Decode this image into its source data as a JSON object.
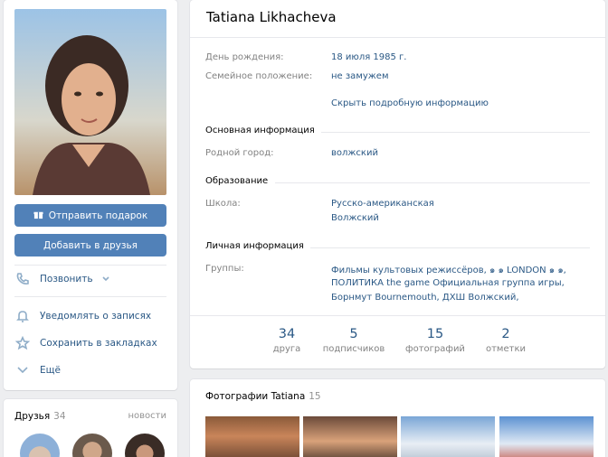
{
  "profile": {
    "name": "Tatiana Likhacheva",
    "birthday_label": "День рождения:",
    "birthday_value": "18 июля 1985 г.",
    "relationship_label": "Семейное положение:",
    "relationship_value": "не замужем",
    "hide_info": "Скрыть подробную информацию",
    "main_info_title": "Основная информация",
    "hometown_label": "Родной город:",
    "hometown_value": "волжский",
    "education_title": "Образование",
    "school_label": "Школа:",
    "school_value_1": "Русско-американская",
    "school_value_2": "Волжский",
    "personal_title": "Личная информация",
    "groups_label": "Группы:",
    "groups_line_1": "Фильмы культовых режиссёров, ๑ ๑ LONDON ๑ ๑,",
    "groups_line_2": "ПОЛИТИКА the game Официальная группа игры,",
    "groups_line_3": "Борнмут Bournemouth, ДХШ Волжский,"
  },
  "stats": [
    {
      "num": "34",
      "cap": "друга"
    },
    {
      "num": "5",
      "cap": "подписчиков"
    },
    {
      "num": "15",
      "cap": "фотографий"
    },
    {
      "num": "2",
      "cap": "отметки"
    }
  ],
  "left": {
    "gift_button": "Отправить подарок",
    "add_friend_button": "Добавить в друзья",
    "call": "Позвонить",
    "notify": "Уведомлять о записях",
    "bookmark": "Сохранить в закладках",
    "more": "Ещё"
  },
  "friends": {
    "title": "Друзья",
    "count": "34",
    "news": "новости"
  },
  "photos": {
    "title": "Фотографии Tatiana",
    "count": "15"
  },
  "colors": {
    "accent": "#5181b8",
    "link": "#2a5885",
    "background": "#edeef0"
  }
}
